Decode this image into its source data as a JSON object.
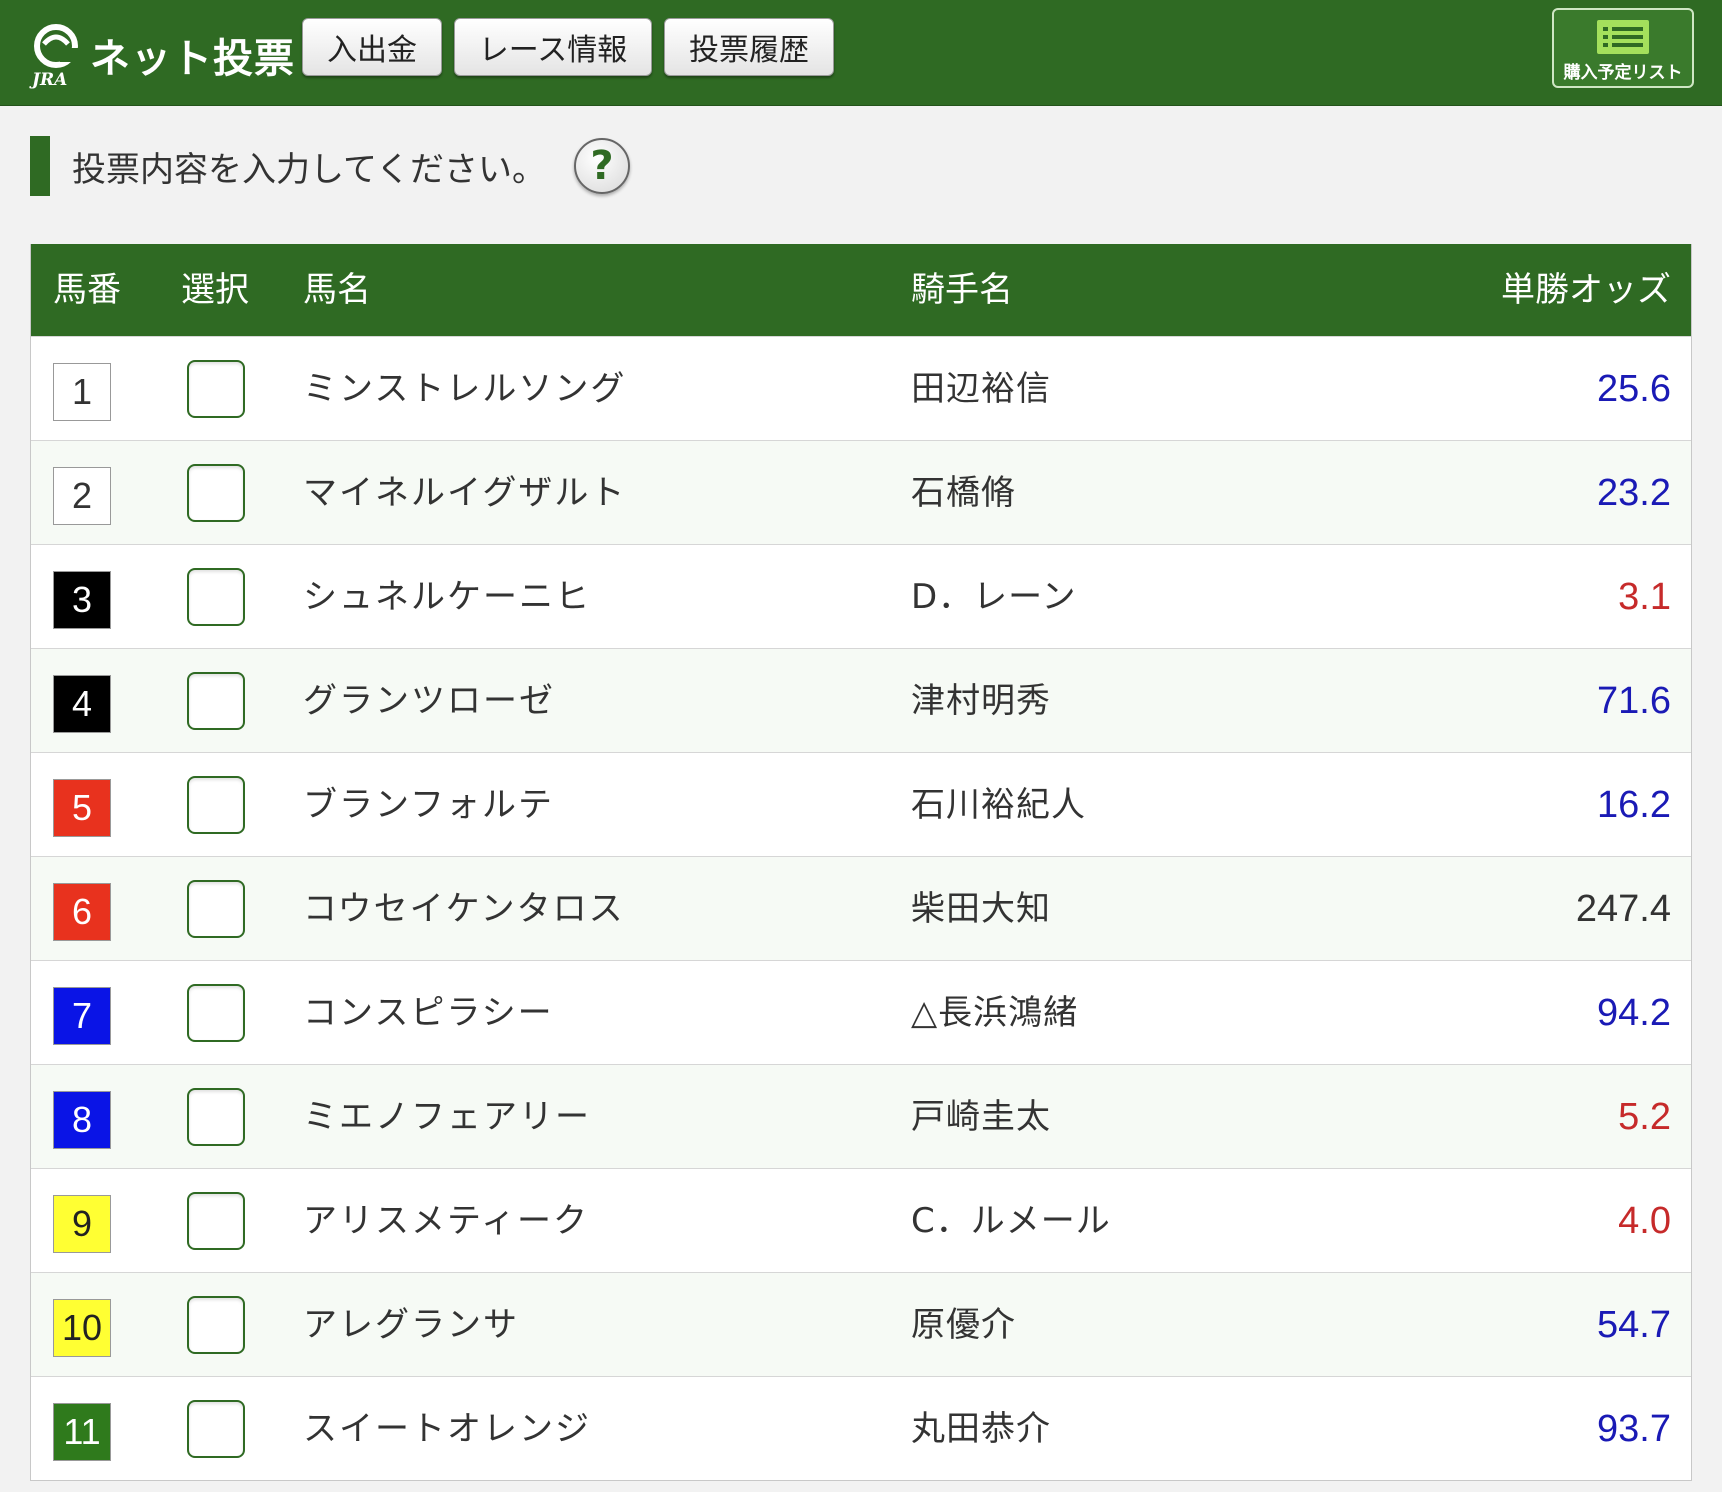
{
  "header": {
    "logo_text": "JRA",
    "title": "ネット投票",
    "nav": [
      {
        "label": "入出金"
      },
      {
        "label": "レース情報"
      },
      {
        "label": "投票履歴"
      }
    ],
    "cart_label": "購入予定リスト",
    "cart_icon": "list-icon"
  },
  "instruction": {
    "text": "投票内容を入力してください。",
    "help_label": "?"
  },
  "table": {
    "columns": [
      "馬番",
      "選択",
      "馬名",
      "騎手名",
      "単勝オッズ"
    ],
    "rows": [
      {
        "num": "1",
        "horse": "ミンストレルソング",
        "jockey": "田辺裕信",
        "odds": "25.6",
        "frame_bg": "#ffffff",
        "frame_fg": "#333333",
        "odds_color": "#1a1ab5"
      },
      {
        "num": "2",
        "horse": "マイネルイグザルト",
        "jockey": "石橋脩",
        "odds": "23.2",
        "frame_bg": "#ffffff",
        "frame_fg": "#333333",
        "odds_color": "#1a1ab5"
      },
      {
        "num": "3",
        "horse": "シュネルケーニヒ",
        "jockey": "D．レーン",
        "odds": "3.1",
        "frame_bg": "#000000",
        "frame_fg": "#ffffff",
        "odds_color": "#c62a2a"
      },
      {
        "num": "4",
        "horse": "グランツローゼ",
        "jockey": "津村明秀",
        "odds": "71.6",
        "frame_bg": "#000000",
        "frame_fg": "#ffffff",
        "odds_color": "#1a1ab5"
      },
      {
        "num": "5",
        "horse": "ブランフォルテ",
        "jockey": "石川裕紀人",
        "odds": "16.2",
        "frame_bg": "#e8321e",
        "frame_fg": "#ffffff",
        "odds_color": "#1a1ab5"
      },
      {
        "num": "6",
        "horse": "コウセイケンタロス",
        "jockey": "柴田大知",
        "odds": "247.4",
        "frame_bg": "#e8321e",
        "frame_fg": "#ffffff",
        "odds_color": "#333333"
      },
      {
        "num": "7",
        "horse": "コンスピラシー",
        "jockey": "△長浜鴻緒",
        "odds": "94.2",
        "frame_bg": "#0a14e6",
        "frame_fg": "#ffffff",
        "odds_color": "#1a1ab5"
      },
      {
        "num": "8",
        "horse": "ミエノフェアリー",
        "jockey": "戸崎圭太",
        "odds": "5.2",
        "frame_bg": "#0a14e6",
        "frame_fg": "#ffffff",
        "odds_color": "#c62a2a"
      },
      {
        "num": "9",
        "horse": "アリスメティーク",
        "jockey": "C．ルメール",
        "odds": "4.0",
        "frame_bg": "#ffff33",
        "frame_fg": "#222222",
        "odds_color": "#c62a2a"
      },
      {
        "num": "10",
        "horse": "アレグランサ",
        "jockey": "原優介",
        "odds": "54.7",
        "frame_bg": "#ffff33",
        "frame_fg": "#222222",
        "odds_color": "#1a1ab5"
      },
      {
        "num": "11",
        "horse": "スイートオレンジ",
        "jockey": "丸田恭介",
        "odds": "93.7",
        "frame_bg": "#2f7a1c",
        "frame_fg": "#ffffff",
        "odds_color": "#1a1ab5"
      }
    ]
  },
  "colors": {
    "brand_green": "#2f6a23",
    "odds_low": "#c62a2a",
    "odds_normal": "#1a1ab5"
  }
}
